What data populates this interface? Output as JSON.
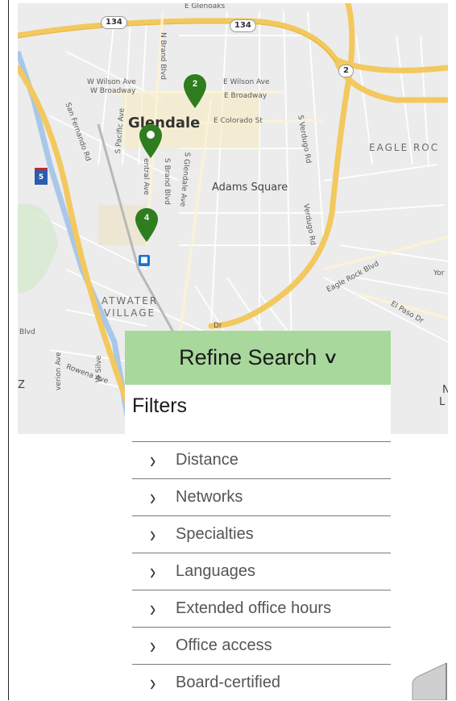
{
  "map": {
    "city": "Glendale",
    "neighborhood": "Adams Square",
    "district": "ATWATER VILLAGE",
    "district_right": "EAGLE ROC",
    "streets": {
      "glenoaks": "E Glenoaks",
      "wilson_w": "W Wilson Ave",
      "broadway_w": "W Broadway",
      "wilson_e": "E Wilson Ave",
      "broadway_e": "E Broadway",
      "colorado": "E Colorado St",
      "brand_n": "N Brand Blvd",
      "brand_s": "S Brand Blvd",
      "glendale_ave": "S Glendale Ave",
      "central": "entral Ave",
      "pacific": "S Pacific Ave",
      "san_fernando": "San Fernando Rd",
      "verdugo_s": "S Verdugo Rd",
      "verdugo": "Verdugo Rd",
      "eagle_rock": "Eagle Rock Blvd",
      "el_paso": "El Paso Dr",
      "rowena": "Rowena Ave",
      "dr": "Dr",
      "blvd": "Blvd",
      "yor": "Yor",
      "w_silv": "W Silve",
      "verion": "verion Ave",
      "z": "Z",
      "n": "N",
      "l": "L"
    },
    "shields": {
      "route_134_a": "134",
      "route_134_b": "134",
      "route_2": "2",
      "interstate_5": "5"
    },
    "pins": [
      {
        "label": "2",
        "color": "#2e7d1e"
      },
      {
        "label": "",
        "color": "#2e7d1e"
      },
      {
        "label": "4",
        "color": "#2e7d1e"
      }
    ]
  },
  "refine": {
    "label": "Refine Search",
    "chevron": "∨",
    "background": "#a8d89c"
  },
  "filters": {
    "title": "Filters",
    "items": [
      {
        "label": "Distance"
      },
      {
        "label": "Networks"
      },
      {
        "label": "Specialties"
      },
      {
        "label": "Languages"
      },
      {
        "label": "Extended office hours"
      },
      {
        "label": "Office access"
      },
      {
        "label": "Board-certified"
      }
    ],
    "arrow": "›"
  }
}
